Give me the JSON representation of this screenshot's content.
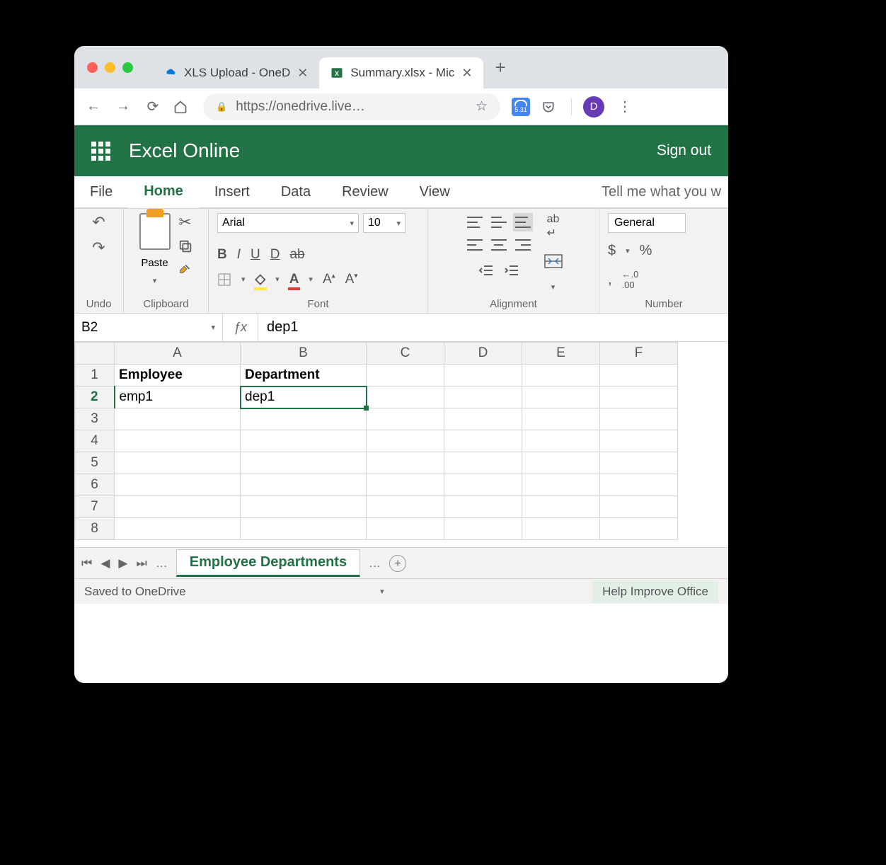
{
  "browser": {
    "tabs": [
      {
        "title": "XLS Upload - OneD",
        "active": false
      },
      {
        "title": "Summary.xlsx - Mic",
        "active": true
      }
    ],
    "url": "https://onedrive.live…",
    "extension_badge": "5.31",
    "profile_initial": "D"
  },
  "app": {
    "name": "Excel Online",
    "sign_out": "Sign out"
  },
  "ribbon": {
    "tabs": [
      "File",
      "Home",
      "Insert",
      "Data",
      "Review",
      "View"
    ],
    "active_tab": "Home",
    "tell_me": "Tell me what you w",
    "groups": {
      "undo": "Undo",
      "clipboard": "Clipboard",
      "clipboard_paste": "Paste",
      "font": "Font",
      "alignment": "Alignment",
      "number": "Number"
    },
    "font_name": "Arial",
    "font_size": "10",
    "number_format": "General"
  },
  "formula_bar": {
    "name_box": "B2",
    "value": "dep1"
  },
  "grid": {
    "columns": [
      "A",
      "B",
      "C",
      "D",
      "E",
      "F"
    ],
    "selected_col": "B",
    "selected_row": 2,
    "rows": [
      {
        "n": 1,
        "cells": [
          "Employee",
          "Department",
          "",
          "",
          "",
          ""
        ],
        "bold": true
      },
      {
        "n": 2,
        "cells": [
          "emp1",
          "dep1",
          "",
          "",
          "",
          ""
        ]
      },
      {
        "n": 3,
        "cells": [
          "",
          "",
          "",
          "",
          "",
          ""
        ]
      },
      {
        "n": 4,
        "cells": [
          "",
          "",
          "",
          "",
          "",
          ""
        ]
      },
      {
        "n": 5,
        "cells": [
          "",
          "",
          "",
          "",
          "",
          ""
        ]
      },
      {
        "n": 6,
        "cells": [
          "",
          "",
          "",
          "",
          "",
          ""
        ]
      },
      {
        "n": 7,
        "cells": [
          "",
          "",
          "",
          "",
          "",
          ""
        ]
      },
      {
        "n": 8,
        "cells": [
          "",
          "",
          "",
          "",
          "",
          ""
        ]
      }
    ]
  },
  "sheet_tabs": {
    "active": "Employee Departments"
  },
  "status": {
    "saved": "Saved to OneDrive",
    "help": "Help Improve Office"
  }
}
